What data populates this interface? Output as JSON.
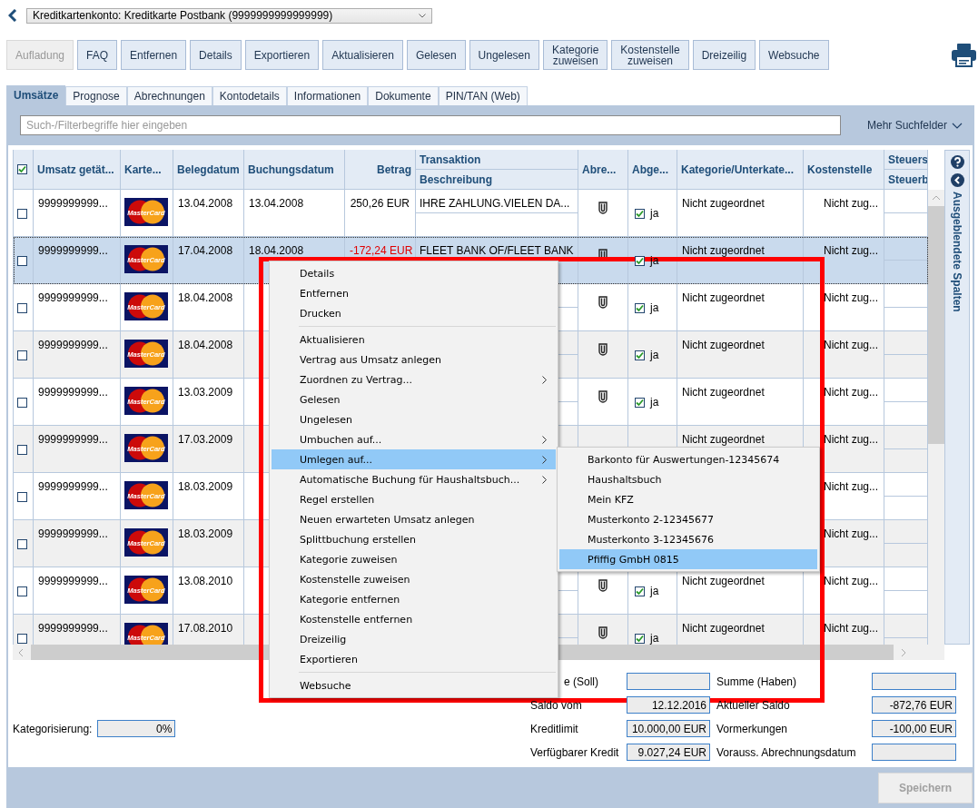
{
  "account_selector": {
    "value": "Kreditkartenkonto: Kreditkarte Postbank (9999999999999999)"
  },
  "toolbar": [
    {
      "label": "Aufladung",
      "disabled": true
    },
    {
      "label": "FAQ",
      "disabled": false
    },
    {
      "label": "Entfernen",
      "disabled": false
    },
    {
      "label": "Details",
      "disabled": false
    },
    {
      "label": "Exportieren",
      "disabled": false
    },
    {
      "label": "Aktualisieren",
      "disabled": false
    },
    {
      "label": "Gelesen",
      "disabled": false
    },
    {
      "label": "Ungelesen",
      "disabled": false
    },
    {
      "label": "Kategorie\nzuweisen",
      "disabled": false
    },
    {
      "label": "Kostenstelle\nzuweisen",
      "disabled": false
    },
    {
      "label": "Dreizeilig",
      "disabled": false
    },
    {
      "label": "Websuche",
      "disabled": false
    }
  ],
  "tabs": [
    {
      "label": "Umsätze",
      "selected": true
    },
    {
      "label": "Prognose",
      "selected": false
    },
    {
      "label": "Abrechnungen",
      "selected": false
    },
    {
      "label": "Kontodetails",
      "selected": false
    },
    {
      "label": "Informationen",
      "selected": false
    },
    {
      "label": "Dokumente",
      "selected": false
    },
    {
      "label": "PIN/TAN (Web)",
      "selected": false
    }
  ],
  "search": {
    "placeholder": "Such-/Filterbegriffe hier eingeben",
    "more_fields": "Mehr Suchfelder"
  },
  "table": {
    "select_all_checked": true,
    "columns": [
      {
        "label": "Umsatz getät..."
      },
      {
        "label": "Karte..."
      },
      {
        "label": "Belegdatum"
      },
      {
        "label": "Buchungsdatum"
      },
      {
        "label": "Betrag"
      },
      {
        "label": "Transaktion",
        "sublabel": "Beschreibung"
      },
      {
        "label": "Abre..."
      },
      {
        "label": "Abge..."
      },
      {
        "label": "Kategorie/Unterkate..."
      },
      {
        "label": "Kostenstelle"
      },
      {
        "label": "Steuers",
        "sublabel": "Steuerb"
      }
    ],
    "rows": [
      {
        "selected": false,
        "checked": false,
        "id": "9999999999...",
        "card": "MasterCard",
        "beleg": "13.04.2008",
        "buchung": "13.04.2008",
        "betrag": "250,26 EUR",
        "negative": false,
        "beschreibung": "IHRE ZAHLUNG.VIELEN DA...",
        "receipt": true,
        "settled": true,
        "settled_label": "ja",
        "kategorie": "Nicht zugeordnet",
        "kostenstelle": "Nicht zug..."
      },
      {
        "selected": true,
        "checked": false,
        "id": "9999999999...",
        "card": "MasterCard",
        "beleg": "17.04.2008",
        "buchung": "18.04.2008",
        "betrag": "-172,24 EUR",
        "negative": true,
        "beschreibung": "FLEET BANK OF/FLEET BANK",
        "receipt": true,
        "settled": true,
        "settled_label": "ja",
        "kategorie": "Nicht zugeordnet",
        "kostenstelle": "Nicht zug..."
      },
      {
        "selected": false,
        "checked": false,
        "id": "9999999999...",
        "card": "MasterCard",
        "beleg": "18.04.2008",
        "receipt": true,
        "settled": true,
        "settled_label": "ja",
        "kategorie": "Nicht zugeordnet",
        "kostenstelle": "Nicht zug..."
      },
      {
        "selected": false,
        "checked": false,
        "id": "9999999999...",
        "card": "MasterCard",
        "beleg": "18.04.2008",
        "receipt": true,
        "settled": true,
        "settled_label": "ja",
        "kategorie": "Nicht zugeordnet",
        "kostenstelle": "Nicht zug..."
      },
      {
        "selected": false,
        "checked": false,
        "id": "9999999999...",
        "card": "MasterCard",
        "beleg": "13.03.2009",
        "receipt": true,
        "settled": true,
        "settled_label": "ja",
        "kategorie": "Nicht zugeordnet",
        "kostenstelle": "Nicht zug..."
      },
      {
        "selected": false,
        "checked": false,
        "id": "9999999999...",
        "card": "MasterCard",
        "beleg": "17.03.2009",
        "receipt": false,
        "kategorie": "Nicht zugeordnet",
        "kostenstelle": "Nicht zug..."
      },
      {
        "selected": false,
        "checked": false,
        "id": "9999999999...",
        "card": "MasterCard",
        "beleg": "18.03.2009",
        "kostenstelle": "Nicht zug..."
      },
      {
        "selected": false,
        "checked": false,
        "id": "9999999999...",
        "card": "MasterCard",
        "beleg": "18.03.2009",
        "kostenstelle": "Nicht zug..."
      },
      {
        "selected": false,
        "checked": false,
        "id": "9999999999...",
        "card": "MasterCard",
        "beleg": "13.08.2010",
        "receipt": true,
        "settled": true,
        "settled_label": "ja",
        "kategorie": "Nicht zugeordnet",
        "kostenstelle": "Nicht zug..."
      },
      {
        "selected": false,
        "checked": false,
        "id": "9999999999...",
        "card": "MasterCard",
        "beleg": "17.08.2010",
        "receipt": true,
        "settled": true,
        "settled_label": "ja",
        "kategorie": "Nicht zugeordnet",
        "kostenstelle": "Nicht zug..."
      }
    ]
  },
  "side_panel": {
    "label": "Ausgeblendete Spalten"
  },
  "context_menu": {
    "groups": [
      [
        {
          "label": "Details",
          "submenu": false,
          "selected": false
        },
        {
          "label": "Entfernen",
          "submenu": false,
          "selected": false
        },
        {
          "label": "Drucken",
          "submenu": false,
          "selected": false
        }
      ],
      [
        {
          "label": "Aktualisieren",
          "submenu": false,
          "selected": false
        },
        {
          "label": "Vertrag aus Umsatz anlegen",
          "submenu": false,
          "selected": false
        },
        {
          "label": "Zuordnen zu Vertrag...",
          "submenu": true,
          "selected": false
        },
        {
          "label": "Gelesen",
          "submenu": false,
          "selected": false
        },
        {
          "label": "Ungelesen",
          "submenu": false,
          "selected": false
        },
        {
          "label": "Umbuchen auf...",
          "submenu": true,
          "selected": false
        },
        {
          "label": "Umlegen auf...",
          "submenu": true,
          "selected": true
        },
        {
          "label": "Automatische Buchung für Haushaltsbuch...",
          "submenu": true,
          "selected": false
        },
        {
          "label": "Regel erstellen",
          "submenu": false,
          "selected": false
        },
        {
          "label": "Neuen erwarteten Umsatz anlegen",
          "submenu": false,
          "selected": false
        },
        {
          "label": "Splittbuchung erstellen",
          "submenu": false,
          "selected": false
        },
        {
          "label": "Kategorie zuweisen",
          "submenu": false,
          "selected": false
        },
        {
          "label": "Kostenstelle zuweisen",
          "submenu": false,
          "selected": false
        },
        {
          "label": "Kategorie entfernen",
          "submenu": false,
          "selected": false
        },
        {
          "label": "Kostenstelle entfernen",
          "submenu": false,
          "selected": false
        },
        {
          "label": "Dreizeilig",
          "submenu": false,
          "selected": false
        },
        {
          "label": "Exportieren",
          "submenu": false,
          "selected": false
        }
      ],
      [
        {
          "label": "Websuche",
          "submenu": false,
          "selected": false
        }
      ]
    ]
  },
  "submenu": {
    "items": [
      {
        "label": "Barkonto für Auswertungen-12345674",
        "selected": false
      },
      {
        "label": "Haushaltsbuch",
        "selected": false
      },
      {
        "label": "Mein KFZ",
        "selected": false
      },
      {
        "label": "Musterkonto 2-12345677",
        "selected": false
      },
      {
        "label": "Musterkonto 3-12345676",
        "selected": false
      },
      {
        "label": "Pfiffig GmbH 0815",
        "selected": true
      }
    ]
  },
  "summary": {
    "categorization": {
      "label": "Kategorisierung:",
      "value": "0%"
    },
    "rows": [
      {
        "left_label": "e (Soll)",
        "right_label": "Summe (Haben)"
      },
      {
        "left_label": "Saldo vom",
        "left_value": "12.12.2016",
        "right_label": "Aktueller Saldo",
        "right_value": "-872,76 EUR"
      },
      {
        "left_label": "Kreditlimit",
        "left_value": "10.000,00 EUR",
        "right_label": "Vormerkungen",
        "right_value": "-100,00 EUR"
      },
      {
        "left_label": "Verfügbarer Kredit",
        "left_value": "9.027,24 EUR",
        "right_label": "Vorauss. Abrechnungsdatum"
      }
    ]
  },
  "save_button": {
    "label": "Speichern",
    "disabled": true
  }
}
